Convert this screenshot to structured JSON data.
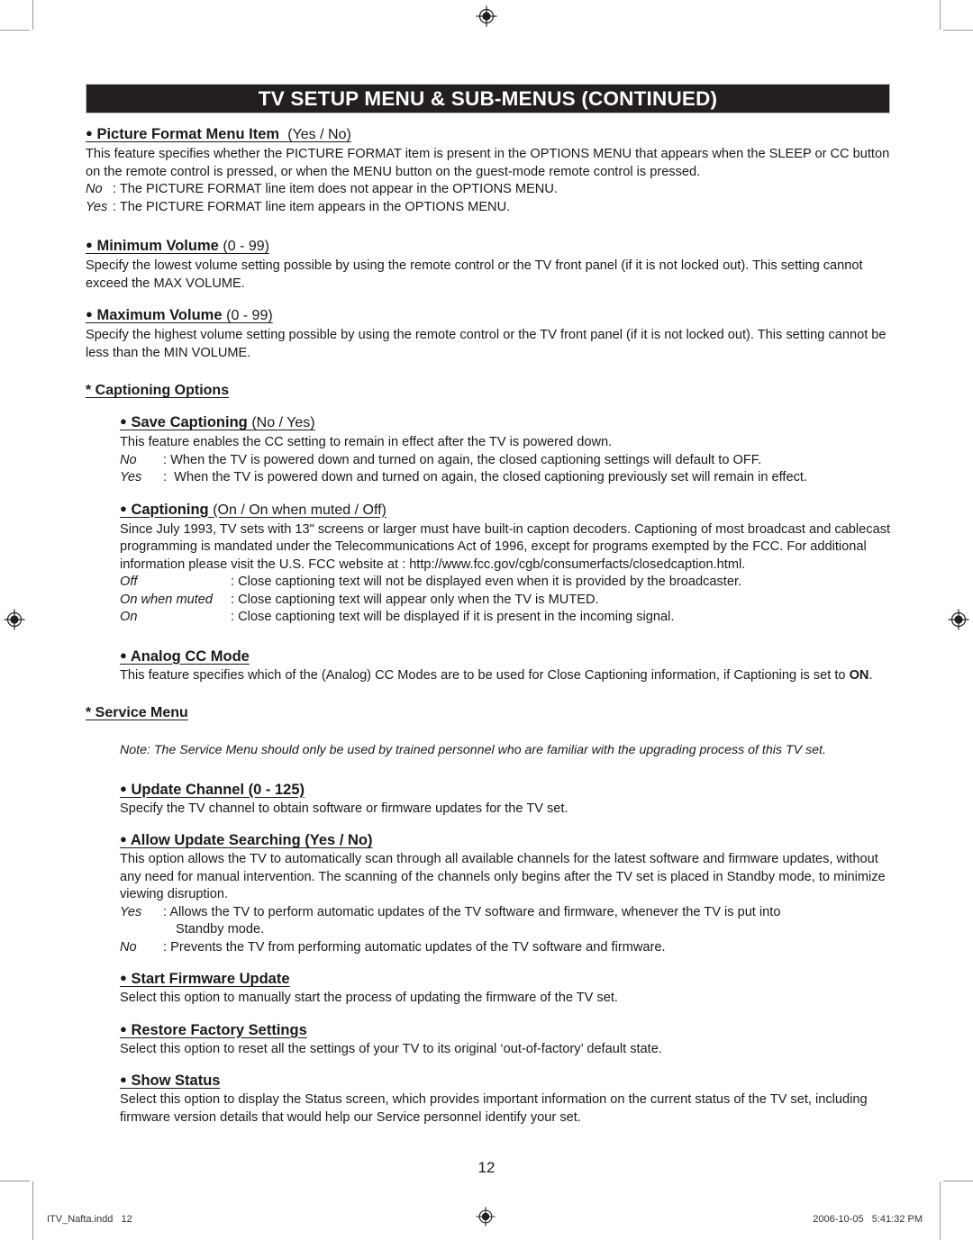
{
  "header": {
    "title": "TV SETUP MENU & SUB-MENUS (CONTINUED)"
  },
  "page_number": "12",
  "footer": {
    "file_label": "ITV_Nafta.indd   12",
    "timestamp": "2006-10-05   5:41:32 PM",
    "registration_icon": "registration-target-icon"
  },
  "colors": {
    "header_bar": "#231f20",
    "header_text": "#ffffff",
    "body_text": "#1a1a1a",
    "crop_mark": "#9a9a9a"
  },
  "sections": {
    "picture_format": {
      "bullet": "●",
      "heading": "Picture Format Menu Item",
      "range": "(Yes / No)",
      "paragraph": "This feature specifies whether the PICTURE FORMAT item is present in the OPTIONS MENU that appears when the SLEEP or CC button on the remote control is pressed, or when the MENU button on the guest-mode remote control is pressed.",
      "options": [
        {
          "key": "No",
          "sep": ":",
          "value": "The PICTURE FORMAT line item does not appear in the OPTIONS MENU."
        },
        {
          "key": "Yes",
          "sep": ":",
          "value": "The PICTURE FORMAT line item appears in the OPTIONS MENU."
        }
      ]
    },
    "minimum_volume": {
      "bullet": "●",
      "heading": "Minimum Volume",
      "range": "(0 - 99)",
      "paragraph": "Specify the lowest volume setting possible by using the remote control or the TV front panel (if it is not locked out).  This setting cannot exceed the MAX VOLUME."
    },
    "maximum_volume": {
      "bullet": "●",
      "heading": "Maximum Volume",
      "range": "(0 - 99)",
      "paragraph": "Specify the highest volume setting possible by using the remote control or the TV front panel (if it is not locked out).  This setting cannot be less than the MIN VOLUME."
    },
    "captioning_options": {
      "heading": "* Captioning Options"
    },
    "save_captioning": {
      "bullet": "●",
      "heading": "Save Captioning",
      "range": "(No / Yes)",
      "paragraph": "This feature enables the CC setting to remain in effect after the TV is powered down.",
      "options": [
        {
          "key": "No",
          "sep": ":",
          "value": "When the TV is powered down and turned on again, the closed captioning settings will default to OFF."
        },
        {
          "key": "Yes",
          "sep": ":",
          "value": "When the TV is powered down and turned on again, the closed captioning previously set will remain in effect."
        }
      ]
    },
    "captioning": {
      "bullet": "●",
      "heading": "Captioning",
      "range": "(On / On when muted / Off)",
      "paragraph": "Since July 1993, TV sets with 13\" screens or larger must have built-in caption decoders.  Captioning of most broadcast and cablecast programming is mandated under the Telecommunications Act of 1996, except for programs exempted by the FCC. For additional information please visit the U.S. FCC website at : http://www.fcc.gov/cgb/consumerfacts/closedcaption.html.",
      "options": [
        {
          "key": "Off",
          "sep": ":",
          "value": "Close captioning text will not be displayed even when it is provided by the broadcaster."
        },
        {
          "key": "On when muted",
          "sep": ":",
          "value": "Close captioning text will appear only when the TV is MUTED."
        },
        {
          "key": "On",
          "sep": ":",
          "value": "Close captioning text will be displayed if it is present in the incoming signal."
        }
      ]
    },
    "analog_cc_mode": {
      "bullet": "●",
      "heading": "Analog CC Mode",
      "paragraph_pre": "This feature specifies which of the (Analog) CC Modes are to be used for Close Captioning information, if Captioning is set to ",
      "paragraph_strong": "ON",
      "paragraph_post": "."
    },
    "service_menu": {
      "heading": "* Service Menu",
      "note": "Note: The Service Menu should only be used by trained personnel who are familiar with the upgrading process of this TV set."
    },
    "update_channel": {
      "bullet": "●",
      "heading": "Update Channel (0 - 125)",
      "paragraph": "Specify the TV channel to obtain software or firmware updates for the TV set."
    },
    "allow_update_searching": {
      "bullet": "●",
      "heading": "Allow Update Searching (Yes / No)",
      "paragraph": "This option allows the TV to automatically scan through all available channels for the latest software and firmware updates, without any need for manual intervention. The scanning of the channels only begins after the TV set is placed in Standby mode, to minimize viewing disruption.",
      "options": [
        {
          "key": "Yes",
          "sep": ":",
          "value": "Allows the TV to perform automatic updates of the TV software and firmware, whenever the TV is put into",
          "continuation": "Standby mode."
        },
        {
          "key": "No",
          "sep": ":",
          "value": "Prevents the TV from performing automatic updates of the TV software and firmware."
        }
      ]
    },
    "start_firmware_update": {
      "bullet": "●",
      "heading": "Start Firmware Update",
      "paragraph": "Select this option to manually start the process of updating the firmware of the TV set."
    },
    "restore_factory_settings": {
      "bullet": "●",
      "heading": "Restore Factory Settings",
      "paragraph": "Select this option to reset all the settings of your TV to its original ‘out-of-factory’ default state."
    },
    "show_status": {
      "bullet": "●",
      "heading": "Show Status",
      "paragraph": "Select this option to display the Status screen, which provides important information on the current status of the TV set, including firmware version details that would help our Service personnel identify your set."
    }
  }
}
